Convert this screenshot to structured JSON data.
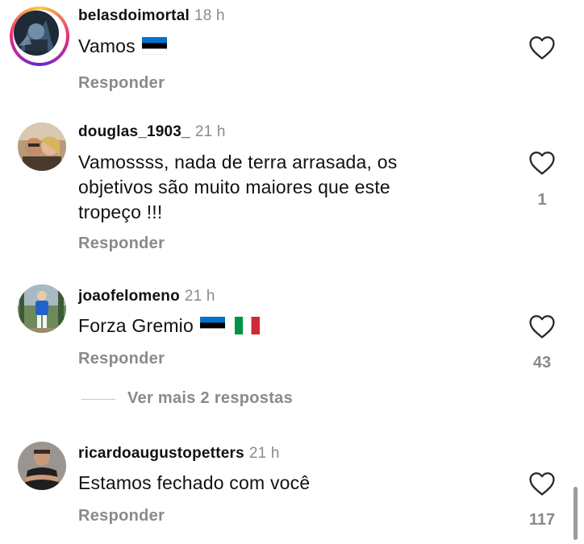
{
  "comments": [
    {
      "username": "belasdoimortal",
      "time": "18 h",
      "text": "Vamos",
      "flags": [
        "estonia-flag-icon"
      ],
      "reply_label": "Responder",
      "likes": "",
      "has_story": true
    },
    {
      "username": "douglas_1903_",
      "time": "21 h",
      "lines": [
        "Vamossss, nada de terra arrasada,  os",
        "objetivos são muito maiores que este",
        "tropeço !!!"
      ],
      "reply_label": "Responder",
      "likes": "1"
    },
    {
      "username": "joaofelomeno",
      "time": "21 h",
      "text": "Forza Gremio",
      "flags": [
        "estonia-flag-icon",
        "italy-flag-icon"
      ],
      "reply_label": "Responder",
      "likes": "43"
    },
    {
      "username": "ricardoaugustopetters",
      "time": "21 h",
      "text": "Estamos fechado com você",
      "reply_label": "Responder",
      "likes": "117"
    }
  ],
  "view_more_replies": "Ver mais 2 respostas",
  "colors": {
    "secondary_text": "#8a8a8a",
    "estonia": [
      "#0072CE",
      "#000000",
      "#FFFFFF"
    ],
    "italy": [
      "#009246",
      "#FFFFFF",
      "#CE2B37"
    ]
  }
}
